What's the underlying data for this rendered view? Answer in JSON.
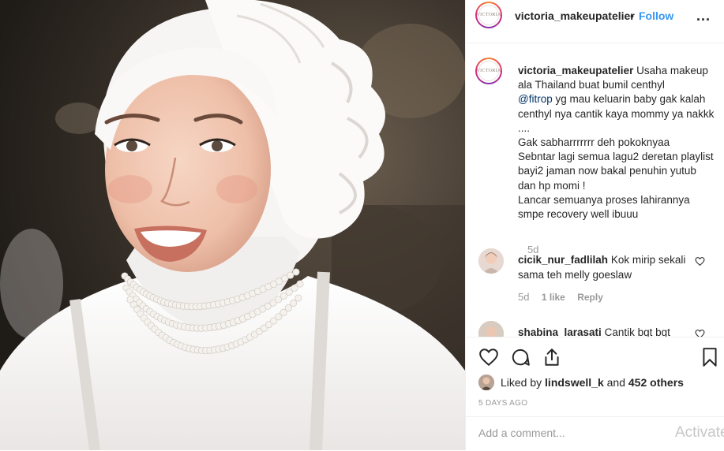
{
  "post": {
    "photo_alt": "Makeup look photo"
  },
  "header": {
    "avatar_logo": "VICTORIA",
    "username": "victoria_makeupatelier",
    "separator": "•",
    "follow_label": "Follow",
    "more_label": "..."
  },
  "caption": {
    "username": "victoria_makeupatelier",
    "text_before_mention": "Usaha makeup ala Thailand buat bumil centhyl",
    "mention": "@fitrop",
    "text_after_mention": "yg mau keluarin baby gak kalah centhyl nya cantik kaya mommy ya nakkk ....\nGak sabharrrrrrr deh pokoknyaa\nSebntar lagi semua lagu2 deretan playlist bayi2 jaman now bakal penuhin yutub dan hp momi !\nLancar semuanya proses lahirannya smpe recovery well ibuuu",
    "time": "5d"
  },
  "comments": [
    {
      "username": "cicik_nur_fadlilah",
      "text": "Kok mirip sekali sama teh melly goeslaw",
      "time": "5d",
      "likes": "1 like",
      "reply": "Reply"
    },
    {
      "username": "shabina_larasati",
      "text": "Cantik bgt bgt",
      "time": "",
      "likes": "",
      "reply": ""
    }
  ],
  "actions": {
    "like_icon": "heart-icon",
    "comment_icon": "comment-icon",
    "share_icon": "share-icon",
    "save_icon": "bookmark-icon"
  },
  "likes": {
    "prefix": "Liked by",
    "user": "lindswell_k",
    "middle": "and",
    "others": "452 others"
  },
  "date": "5 DAYS AGO",
  "add_comment": {
    "placeholder": "Add a comment...",
    "watermark": "Activate"
  },
  "colors": {
    "link_blue": "#3897f0",
    "text": "#262626",
    "muted": "#999999",
    "border": "#efefef"
  }
}
